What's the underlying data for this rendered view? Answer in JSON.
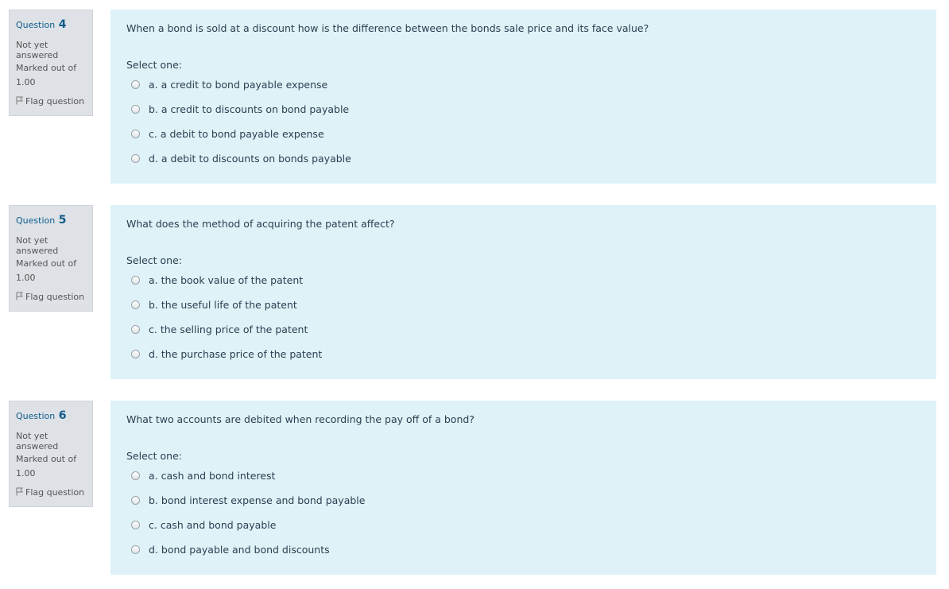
{
  "questions": [
    {
      "label": "Question",
      "number": "4",
      "state": "Not yet answered",
      "marked_out_of": "Marked out of",
      "grade": "1.00",
      "flag_label": "Flag question",
      "text": "When a bond is sold at a discount how is the difference between the bonds sale price and its face value?",
      "prompt": "Select one:",
      "options": [
        "a. a credit to bond payable expense",
        "b. a credit to discounts on bond payable",
        "c. a debit to bond payable expense",
        "d. a debit to discounts on bonds payable"
      ]
    },
    {
      "label": "Question",
      "number": "5",
      "state": "Not yet answered",
      "marked_out_of": "Marked out of",
      "grade": "1.00",
      "flag_label": "Flag question",
      "text": "What does the method of acquiring the patent affect?",
      "prompt": "Select one:",
      "options": [
        "a. the book value of the patent",
        "b. the useful life of the patent",
        "c. the selling price of the patent",
        "d. the purchase price of the patent"
      ]
    },
    {
      "label": "Question",
      "number": "6",
      "state": "Not yet answered",
      "marked_out_of": "Marked out of",
      "grade": "1.00",
      "flag_label": "Flag question",
      "text": "What two accounts are debited when recording the pay off of a bond?",
      "prompt": "Select one:",
      "options": [
        "a. cash and bond interest",
        "b. bond interest expense and bond payable",
        "c. cash and bond payable",
        "d. bond payable and bond discounts"
      ]
    }
  ]
}
